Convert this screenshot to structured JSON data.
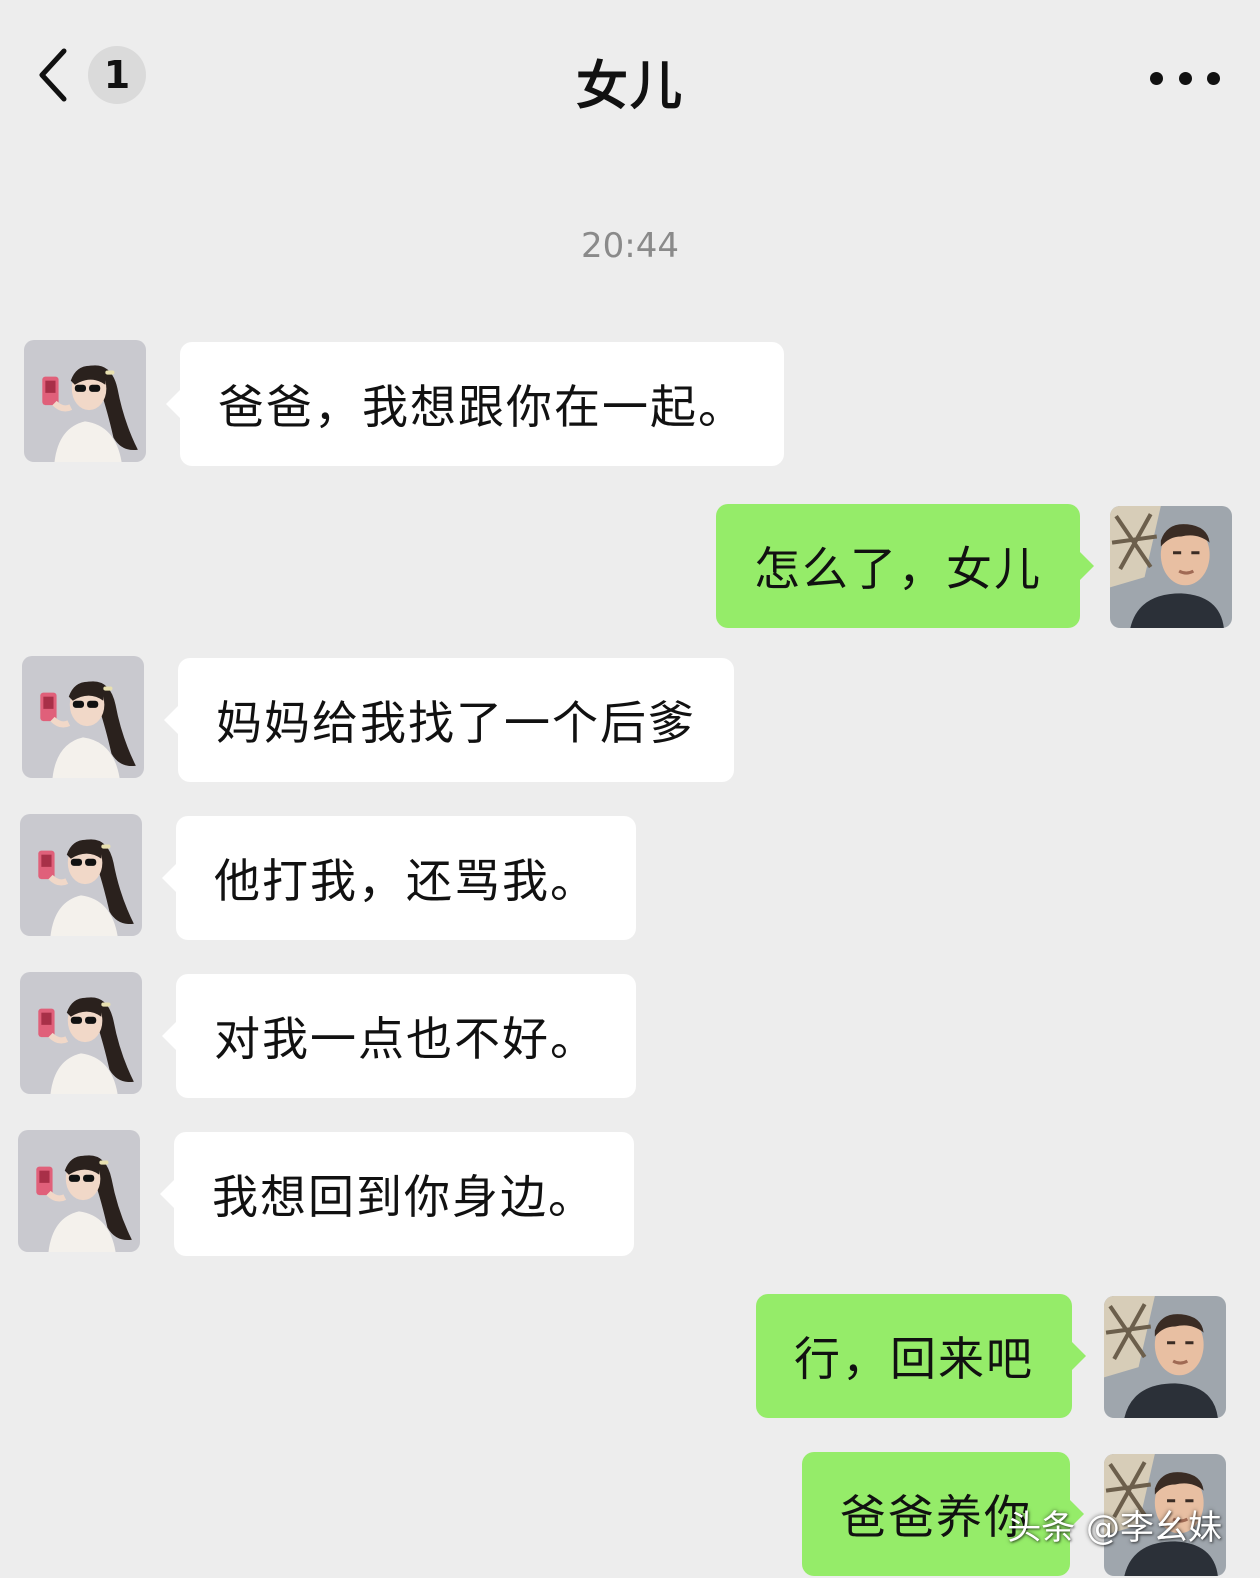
{
  "header": {
    "back_icon": "chevron-left-icon",
    "unread_count": "1",
    "title": "女儿",
    "more_icon": "ellipsis-icon"
  },
  "timestamp": "20:44",
  "messages": [
    {
      "side": "left",
      "text": "爸爸，我想跟你在一起。"
    },
    {
      "side": "right",
      "text": "怎么了，女儿"
    },
    {
      "side": "left",
      "text": "妈妈给我找了一个后爹"
    },
    {
      "side": "left",
      "text": "他打我，还骂我。"
    },
    {
      "side": "left",
      "text": "对我一点也不好。"
    },
    {
      "side": "left",
      "text": "我想回到你身边。"
    },
    {
      "side": "right",
      "text": "行，回来吧"
    },
    {
      "side": "right",
      "text": "爸爸养你"
    }
  ],
  "watermark": "头条 @李幺妹",
  "colors": {
    "background": "#ededed",
    "incoming_bubble": "#ffffff",
    "outgoing_bubble": "#95ec69"
  }
}
